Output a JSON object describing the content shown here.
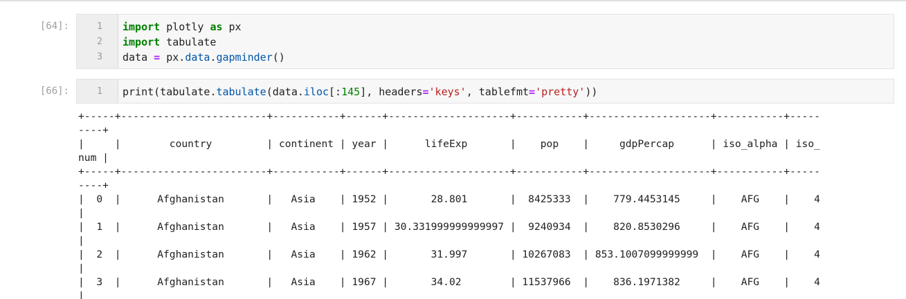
{
  "cells": [
    {
      "prompt": "[64]:",
      "line_numbers": [
        "1",
        "2",
        "3"
      ],
      "lines": [
        [
          {
            "t": "import",
            "c": "kw"
          },
          {
            "t": " plotly ",
            "c": ""
          },
          {
            "t": "as",
            "c": "kw"
          },
          {
            "t": " px",
            "c": ""
          }
        ],
        [
          {
            "t": "import",
            "c": "kw"
          },
          {
            "t": " tabulate",
            "c": ""
          }
        ],
        [
          {
            "t": "data ",
            "c": ""
          },
          {
            "t": "=",
            "c": "op"
          },
          {
            "t": " px",
            "c": ""
          },
          {
            "t": ".",
            "c": ""
          },
          {
            "t": "data",
            "c": "attr"
          },
          {
            "t": ".",
            "c": ""
          },
          {
            "t": "gapminder",
            "c": "attr"
          },
          {
            "t": "()",
            "c": ""
          }
        ]
      ]
    },
    {
      "prompt": "[66]:",
      "line_numbers": [
        "1"
      ],
      "lines": [
        [
          {
            "t": "print",
            "c": ""
          },
          {
            "t": "(tabulate",
            "c": ""
          },
          {
            "t": ".",
            "c": ""
          },
          {
            "t": "tabulate",
            "c": "attr"
          },
          {
            "t": "(data",
            "c": ""
          },
          {
            "t": ".",
            "c": ""
          },
          {
            "t": "iloc",
            "c": "attr"
          },
          {
            "t": "[:",
            "c": ""
          },
          {
            "t": "145",
            "c": "num"
          },
          {
            "t": "], headers",
            "c": ""
          },
          {
            "t": "=",
            "c": "op"
          },
          {
            "t": "'keys'",
            "c": "str"
          },
          {
            "t": ", tablefmt",
            "c": ""
          },
          {
            "t": "=",
            "c": "op"
          },
          {
            "t": "'pretty'",
            "c": "str"
          },
          {
            "t": "))",
            "c": ""
          }
        ]
      ]
    }
  ],
  "output": {
    "lines": [
      "+-----+------------------------+-----------+------+--------------------+-----------+--------------------+-----------+-----",
      "----+",
      "|     |        country         | continent | year |      lifeExp       |    pop    |     gdpPercap      | iso_alpha | iso_",
      "num |",
      "+-----+------------------------+-----------+------+--------------------+-----------+--------------------+-----------+-----",
      "----+",
      "|  0  |      Afghanistan       |   Asia    | 1952 |       28.801       |  8425333  |    779.4453145     |    AFG    |    4",
      "|",
      "|  1  |      Afghanistan       |   Asia    | 1957 | 30.331999999999997 |  9240934  |    820.8530296     |    AFG    |    4",
      "|",
      "|  2  |      Afghanistan       |   Asia    | 1962 |       31.997       | 10267083  | 853.1007099999999  |    AFG    |    4",
      "|",
      "|  3  |      Afghanistan       |   Asia    | 1967 |       34.02        | 11537966  |    836.1971382     |    AFG    |    4",
      "|"
    ]
  }
}
